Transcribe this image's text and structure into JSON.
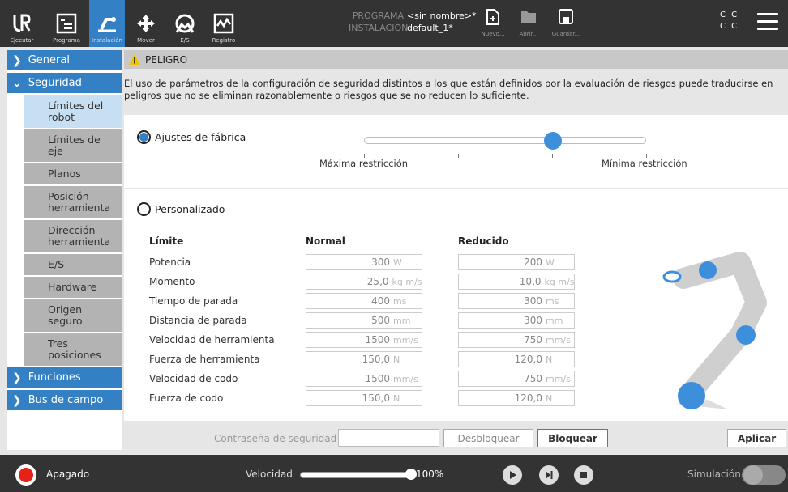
{
  "header": {
    "tabs": [
      {
        "label": "Ejecutar",
        "icon": "ur-logo-icon"
      },
      {
        "label": "Programa",
        "icon": "program-icon"
      },
      {
        "label": "Instalación",
        "icon": "installation-icon",
        "active": true
      },
      {
        "label": "Mover",
        "icon": "move-icon"
      },
      {
        "label": "E/S",
        "icon": "io-icon"
      },
      {
        "label": "Registro",
        "icon": "log-icon"
      }
    ],
    "program_key": "PROGRAMA",
    "program_value": "<sin nombre>*",
    "installation_key": "INSTALACIÓN",
    "installation_value": "default_1*",
    "file_buttons": [
      {
        "label": "Nuevo...",
        "icon": "new-file-icon"
      },
      {
        "label": "Abrir...",
        "icon": "folder-icon"
      },
      {
        "label": "Guardar...",
        "icon": "save-icon"
      }
    ],
    "cc_line1": "C C",
    "cc_line2": "C C"
  },
  "sidebar": {
    "groups": [
      {
        "label": "General"
      },
      {
        "label": "Seguridad"
      },
      {
        "label": "Funciones"
      },
      {
        "label": "Bus de campo"
      }
    ],
    "items": [
      {
        "label": "Límites del robot"
      },
      {
        "label": "Límites de eje"
      },
      {
        "label": "Planos"
      },
      {
        "label": "Posición herramienta"
      },
      {
        "label": "Dirección herramienta"
      },
      {
        "label": "E/S"
      },
      {
        "label": "Hardware"
      },
      {
        "label": "Origen seguro"
      },
      {
        "label": "Tres posiciones"
      }
    ]
  },
  "main": {
    "warning_title": "PELIGRO",
    "warning_text": "El uso de parámetros de la configuración de seguridad distintos a los que están definidos por la evaluación de riesgos puede traducirse en peligros que no se eliminan razonablemente o riesgos que se no reducen lo suficiente.",
    "factory_label": "Ajustes de fábrica",
    "slider_min_label": "Máxima restricción",
    "slider_max_label": "Mínima restricción",
    "slider_level": 0.67,
    "custom_label": "Personalizado",
    "col_limit": "Límite",
    "col_normal": "Normal",
    "col_reduced": "Reducido",
    "limits": [
      {
        "name": "Potencia",
        "normal": "300",
        "reduced": "200",
        "unit": "W"
      },
      {
        "name": "Momento",
        "normal": "25,0",
        "reduced": "10,0",
        "unit": "kg m/s"
      },
      {
        "name": "Tiempo de parada",
        "normal": "400",
        "reduced": "300",
        "unit": "ms"
      },
      {
        "name": "Distancia de parada",
        "normal": "500",
        "reduced": "300",
        "unit": "mm"
      },
      {
        "name": "Velocidad de herramienta",
        "normal": "1500",
        "reduced": "750",
        "unit": "mm/s"
      },
      {
        "name": "Fuerza de herramienta",
        "normal": "150,0",
        "reduced": "120,0",
        "unit": "N"
      },
      {
        "name": "Velocidad de codo",
        "normal": "1500",
        "reduced": "750",
        "unit": "mm/s"
      },
      {
        "name": "Fuerza de codo",
        "normal": "150,0",
        "reduced": "120,0",
        "unit": "N"
      }
    ],
    "password_label": "Contraseña de seguridad",
    "unlock_label": "Desbloquear",
    "lock_label": "Bloquear",
    "apply_label": "Aplicar"
  },
  "footer": {
    "status": "Apagado",
    "speed_label": "Velocidad",
    "speed_value": "100%",
    "speed_level": 1.0,
    "sim_label": "Simulación"
  },
  "colors": {
    "accent": "#3480c4",
    "header": "#333333",
    "stop": "#e62117"
  }
}
